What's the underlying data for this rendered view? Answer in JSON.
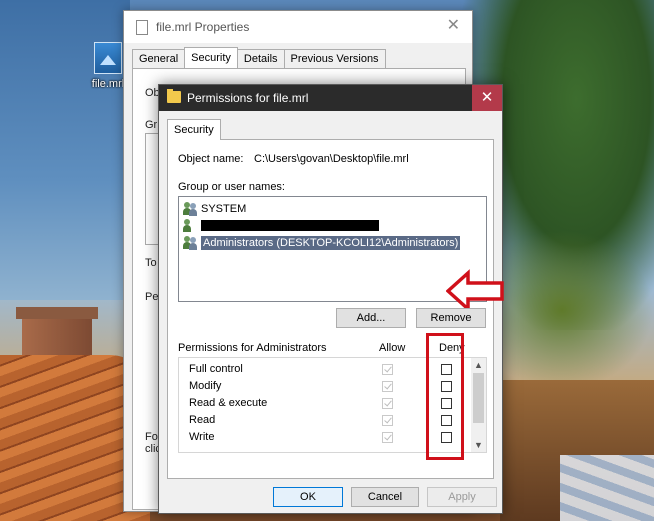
{
  "desktop": {
    "file_icon_label": "file.mrl"
  },
  "properties_window": {
    "title": "file.mrl Properties",
    "tabs": [
      "General",
      "Security",
      "Details",
      "Previous Versions"
    ],
    "active_tab": "Security",
    "obscured_labels": [
      "Obj",
      "Gr",
      "To",
      "Pe",
      "Fo",
      "clic"
    ]
  },
  "permissions_dialog": {
    "title": "Permissions for file.mrl",
    "tab": "Security",
    "object_name_label": "Object name:",
    "object_name_value": "C:\\Users\\govan\\Desktop\\file.mrl",
    "group_label": "Group or user names:",
    "users": [
      {
        "name": "SYSTEM",
        "icon": "user-group-icon",
        "selected": false
      },
      {
        "name": "",
        "icon": "user-icon",
        "selected": false,
        "redacted": true
      },
      {
        "name": "Administrators (DESKTOP-KCOLI12\\Administrators)",
        "icon": "user-group-icon",
        "selected": true
      }
    ],
    "add_button": "Add...",
    "remove_button": "Remove",
    "permissions_header": "Permissions for Administrators",
    "allow_header": "Allow",
    "deny_header": "Deny",
    "permissions": [
      {
        "name": "Full control",
        "allow": true,
        "deny": false
      },
      {
        "name": "Modify",
        "allow": true,
        "deny": false
      },
      {
        "name": "Read & execute",
        "allow": true,
        "deny": false
      },
      {
        "name": "Read",
        "allow": true,
        "deny": false
      },
      {
        "name": "Write",
        "allow": true,
        "deny": false
      }
    ],
    "ok_button": "OK",
    "cancel_button": "Cancel",
    "apply_button": "Apply"
  },
  "annotation_colors": {
    "highlight": "#d0101a",
    "close_button": "#b33a4a"
  }
}
